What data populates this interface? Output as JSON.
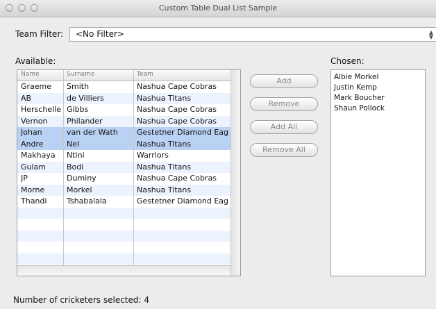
{
  "window": {
    "title": "Custom Table Dual List Sample"
  },
  "filter": {
    "label": "Team Filter:",
    "value": "<No Filter>"
  },
  "available": {
    "label": "Available:",
    "columns": [
      "Name",
      "Surname",
      "Team"
    ],
    "rows": [
      [
        "Graeme",
        "Smith",
        "Nashua Cape Cobras"
      ],
      [
        "AB",
        "de Villiers",
        "Nashua Titans"
      ],
      [
        "Herschelle",
        "Gibbs",
        "Nashua Cape Cobras"
      ],
      [
        "Vernon",
        "Philander",
        "Nashua Cape Cobras"
      ],
      [
        "Johan",
        "van der Wath",
        "Gestetner Diamond Eag"
      ],
      [
        "Andre",
        "Nel",
        "Nashua Titans"
      ],
      [
        "Makhaya",
        "Ntini",
        "Warriors"
      ],
      [
        "Gulam",
        "Bodi",
        "Nashua Titans"
      ],
      [
        "JP",
        "Duminy",
        "Nashua Cape Cobras"
      ],
      [
        "Morne",
        "Morkel",
        "Nashua Titans"
      ],
      [
        "Thandi",
        "Tshabalala",
        "Gestetner Diamond Eag"
      ]
    ],
    "selected_rows": [
      4,
      5
    ]
  },
  "buttons": {
    "add": "Add",
    "remove": "Remove",
    "add_all": "Add All",
    "remove_all": "Remove All"
  },
  "chosen": {
    "label": "Chosen:",
    "items": [
      "Albie Morkel",
      "Justin Kemp",
      "Mark Boucher",
      "Shaun Pollock"
    ]
  },
  "status": {
    "text": "Number of cricketers selected: 4"
  }
}
